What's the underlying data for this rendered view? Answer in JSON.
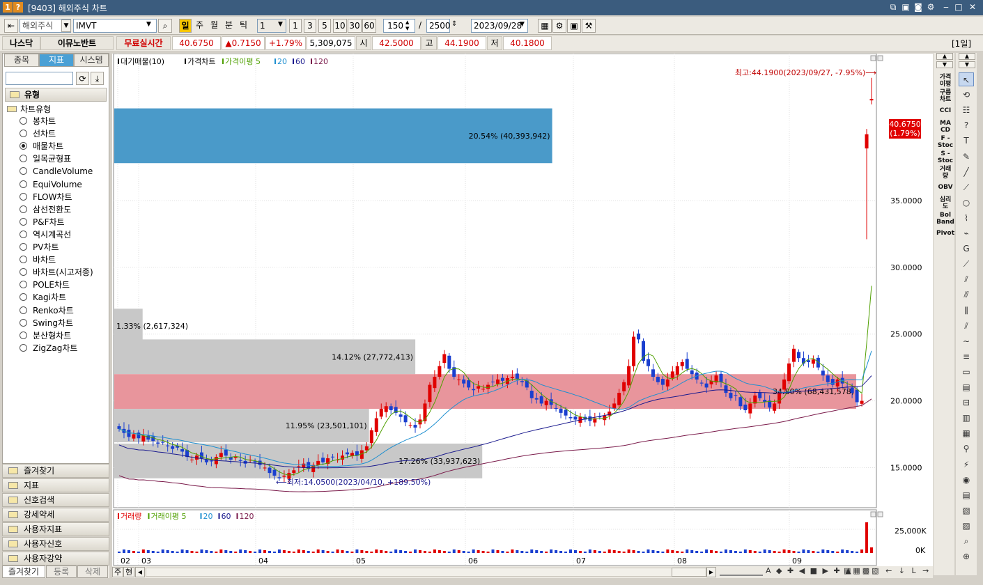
{
  "window": {
    "title": "[9403] 해외주식 차트",
    "badge1": "1",
    "badge2": "?"
  },
  "toolbar": {
    "market": "해외주식",
    "symbol": "IMVT",
    "period_active": "일",
    "periods": [
      "주",
      "월",
      "분",
      "틱"
    ],
    "unit": "1",
    "mults": [
      "1",
      "3",
      "5",
      "10",
      "30",
      "60"
    ],
    "count": "150",
    "slash": "/",
    "total": "2500",
    "date": "2023/09/28"
  },
  "quote": {
    "exchange": "나스닥",
    "name": "이뮤노반트",
    "realtime": "무료실시간",
    "price": "40.6750",
    "change": "▲0.7150",
    "pct": "+1.79%",
    "volume": "5,309,075",
    "open_label": "시",
    "open": "42.5000",
    "high_label": "고",
    "high": "44.1900",
    "low_label": "저",
    "low": "40.1800",
    "interval": "[1일]"
  },
  "left": {
    "tabs": [
      "종목",
      "지표",
      "시스템"
    ],
    "section": "유형",
    "group": "차트유형",
    "items": [
      "봉차트",
      "선차트",
      "매물차트",
      "일목균형표",
      "CandleVolume",
      "EquiVolume",
      "FLOW차트",
      "삼선전환도",
      "P&F차트",
      "역시계곡선",
      "PV차트",
      "바차트",
      "바차트(시고저종)",
      "POLE차트",
      "Kagi차트",
      "Renko차트",
      "Swing차트",
      "분산형차트",
      "ZigZag차트"
    ],
    "selected": 2,
    "folders": [
      "즐겨찾기",
      "지표",
      "신호검색",
      "강세약세",
      "사용자지표",
      "사용자신호",
      "사용자강약"
    ],
    "bottom_tabs": [
      "즐겨찾기",
      "등록",
      "삭제"
    ]
  },
  "chart": {
    "legend": [
      "대기매물(10)",
      "가격차트",
      "가격이평 5",
      "20",
      "60",
      "120"
    ],
    "legend_colors": [
      "#000000",
      "#000000",
      "#4f9f00",
      "#1e8fd0",
      "#1a1a8e",
      "#7a1a4a"
    ],
    "high_note": "최고:44.1900(2023/09/27, -7.95%)",
    "low_note": "최저:14.0500(2023/04/10, +189.50%)",
    "price_tag": "40.6750",
    "price_tag2": "(1.79%)",
    "vol_legend": [
      "거래량",
      "거래이평 5",
      "20",
      "60",
      "120"
    ],
    "vol_ticks": [
      "25,000K",
      "0K"
    ],
    "months": [
      "02",
      "03",
      "04",
      "05",
      "06",
      "07",
      "08",
      "09"
    ],
    "bottom_left": [
      "주",
      "현"
    ]
  },
  "chart_data": {
    "type": "candlestick",
    "ylim": [
      12.0,
      46.0
    ],
    "yticks": [
      "35.0000",
      "30.0000",
      "25.0000",
      "20.0000",
      "15.0000"
    ],
    "ytick_values": [
      35,
      30,
      25,
      20,
      15
    ],
    "volume_profile": [
      {
        "lo": 37.8,
        "hi": 41.9,
        "label": "20.54% (40,393,942)",
        "pct": 20.54
      },
      {
        "lo": 24.3,
        "hi": 26.9,
        "label": "1.33% (2,617,324)",
        "pct": 1.33
      },
      {
        "lo": 22.0,
        "hi": 24.6,
        "label": "14.12% (27,772,413)",
        "pct": 14.12
      },
      {
        "lo": 19.4,
        "hi": 22.0,
        "label": "34.80% (68,431,578)",
        "pct": 34.8
      },
      {
        "lo": 16.9,
        "hi": 19.4,
        "label": "11.95% (23,501,101)",
        "pct": 11.95
      },
      {
        "lo": 14.2,
        "hi": 16.8,
        "label": "17.26% (33,937,623)",
        "pct": 17.26
      }
    ],
    "closes": [
      17.9,
      17.6,
      17.3,
      17.5,
      17.2,
      17.4,
      17.1,
      17.0,
      16.8,
      16.9,
      16.6,
      16.4,
      16.5,
      16.2,
      15.8,
      15.6,
      15.9,
      15.7,
      15.4,
      15.5,
      15.8,
      16.1,
      15.9,
      15.6,
      15.8,
      15.5,
      15.3,
      15.6,
      15.4,
      15.2,
      15.0,
      14.6,
      14.4,
      14.2,
      14.4,
      14.6,
      14.8,
      15.1,
      15.3,
      14.9,
      15.2,
      15.5,
      15.4,
      15.7,
      15.8,
      15.6,
      15.9,
      16.0,
      16.1,
      15.9,
      16.3,
      16.6,
      17.8,
      18.7,
      19.4,
      19.6,
      19.3,
      19.1,
      18.8,
      18.4,
      18.2,
      18.0,
      18.6,
      19.8,
      21.2,
      21.8,
      22.6,
      23.5,
      22.4,
      21.8,
      21.6,
      21.3,
      21.0,
      20.8,
      21.1,
      20.9,
      21.2,
      21.4,
      21.6,
      21.5,
      21.7,
      21.8,
      21.6,
      21.4,
      21.0,
      20.2,
      20.1,
      19.8,
      20.0,
      19.7,
      19.4,
      19.1,
      18.9,
      18.7,
      18.6,
      18.8,
      18.6,
      18.5,
      18.7,
      18.8,
      18.9,
      19.2,
      19.8,
      20.6,
      21.4,
      22.6,
      24.8,
      24.6,
      23.0,
      22.6,
      21.8,
      21.4,
      21.2,
      21.6,
      22.2,
      22.6,
      22.9,
      22.4,
      22.0,
      21.6,
      21.3,
      21.0,
      21.5,
      21.9,
      21.4,
      20.6,
      20.2,
      20.4,
      19.6,
      19.3,
      19.8,
      20.4,
      20.2,
      19.9,
      19.5,
      19.8,
      20.6,
      21.6,
      22.8,
      23.9,
      23.2,
      22.8,
      22.9,
      23.1,
      22.5,
      21.9,
      21.4,
      21.2,
      21.6,
      21.3,
      21.0,
      20.6,
      19.9,
      20.0,
      39.96,
      42.6
    ]
  }
}
